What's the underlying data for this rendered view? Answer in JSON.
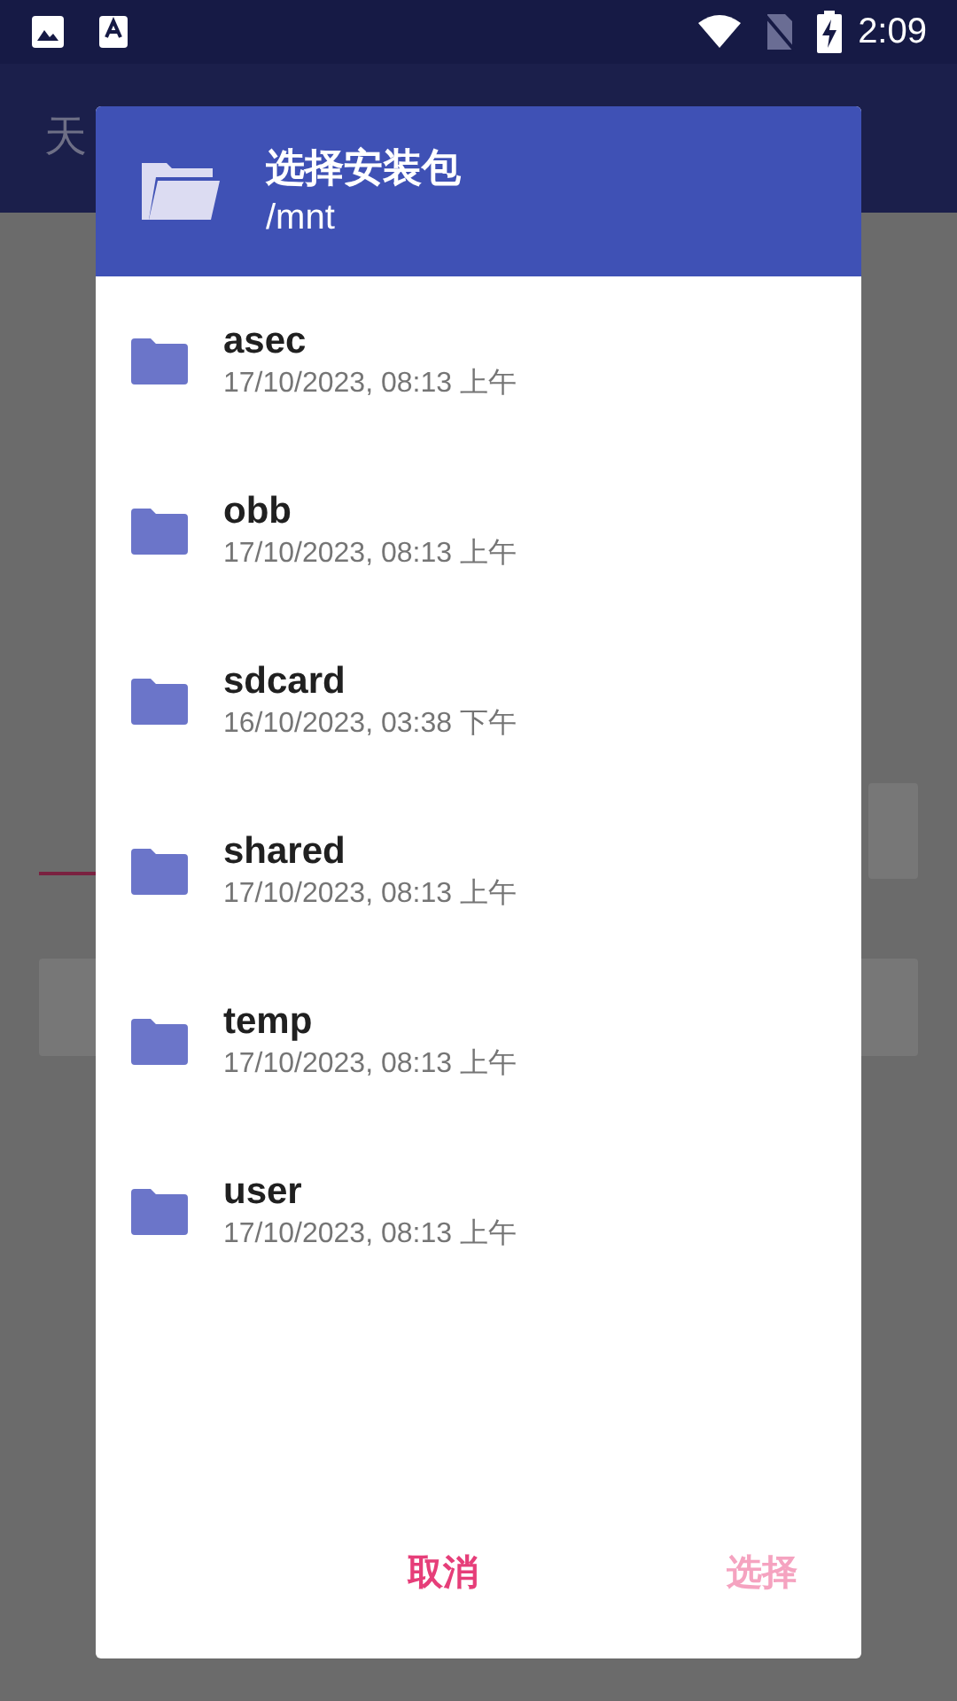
{
  "status_bar": {
    "time": "2:09"
  },
  "app_bar": {
    "title": "天"
  },
  "dialog": {
    "title": "选择安装包",
    "path": "/mnt",
    "items": [
      {
        "name": "asec",
        "date": "17/10/2023, 08:13 上午"
      },
      {
        "name": "obb",
        "date": "17/10/2023, 08:13 上午"
      },
      {
        "name": "sdcard",
        "date": "16/10/2023, 03:38 下午"
      },
      {
        "name": "shared",
        "date": "17/10/2023, 08:13 上午"
      },
      {
        "name": "temp",
        "date": "17/10/2023, 08:13 上午"
      },
      {
        "name": "user",
        "date": "17/10/2023, 08:13 上午"
      }
    ],
    "buttons": [
      {
        "label": "取消",
        "disabled": false
      },
      {
        "label": "选择",
        "disabled": true
      }
    ]
  }
}
